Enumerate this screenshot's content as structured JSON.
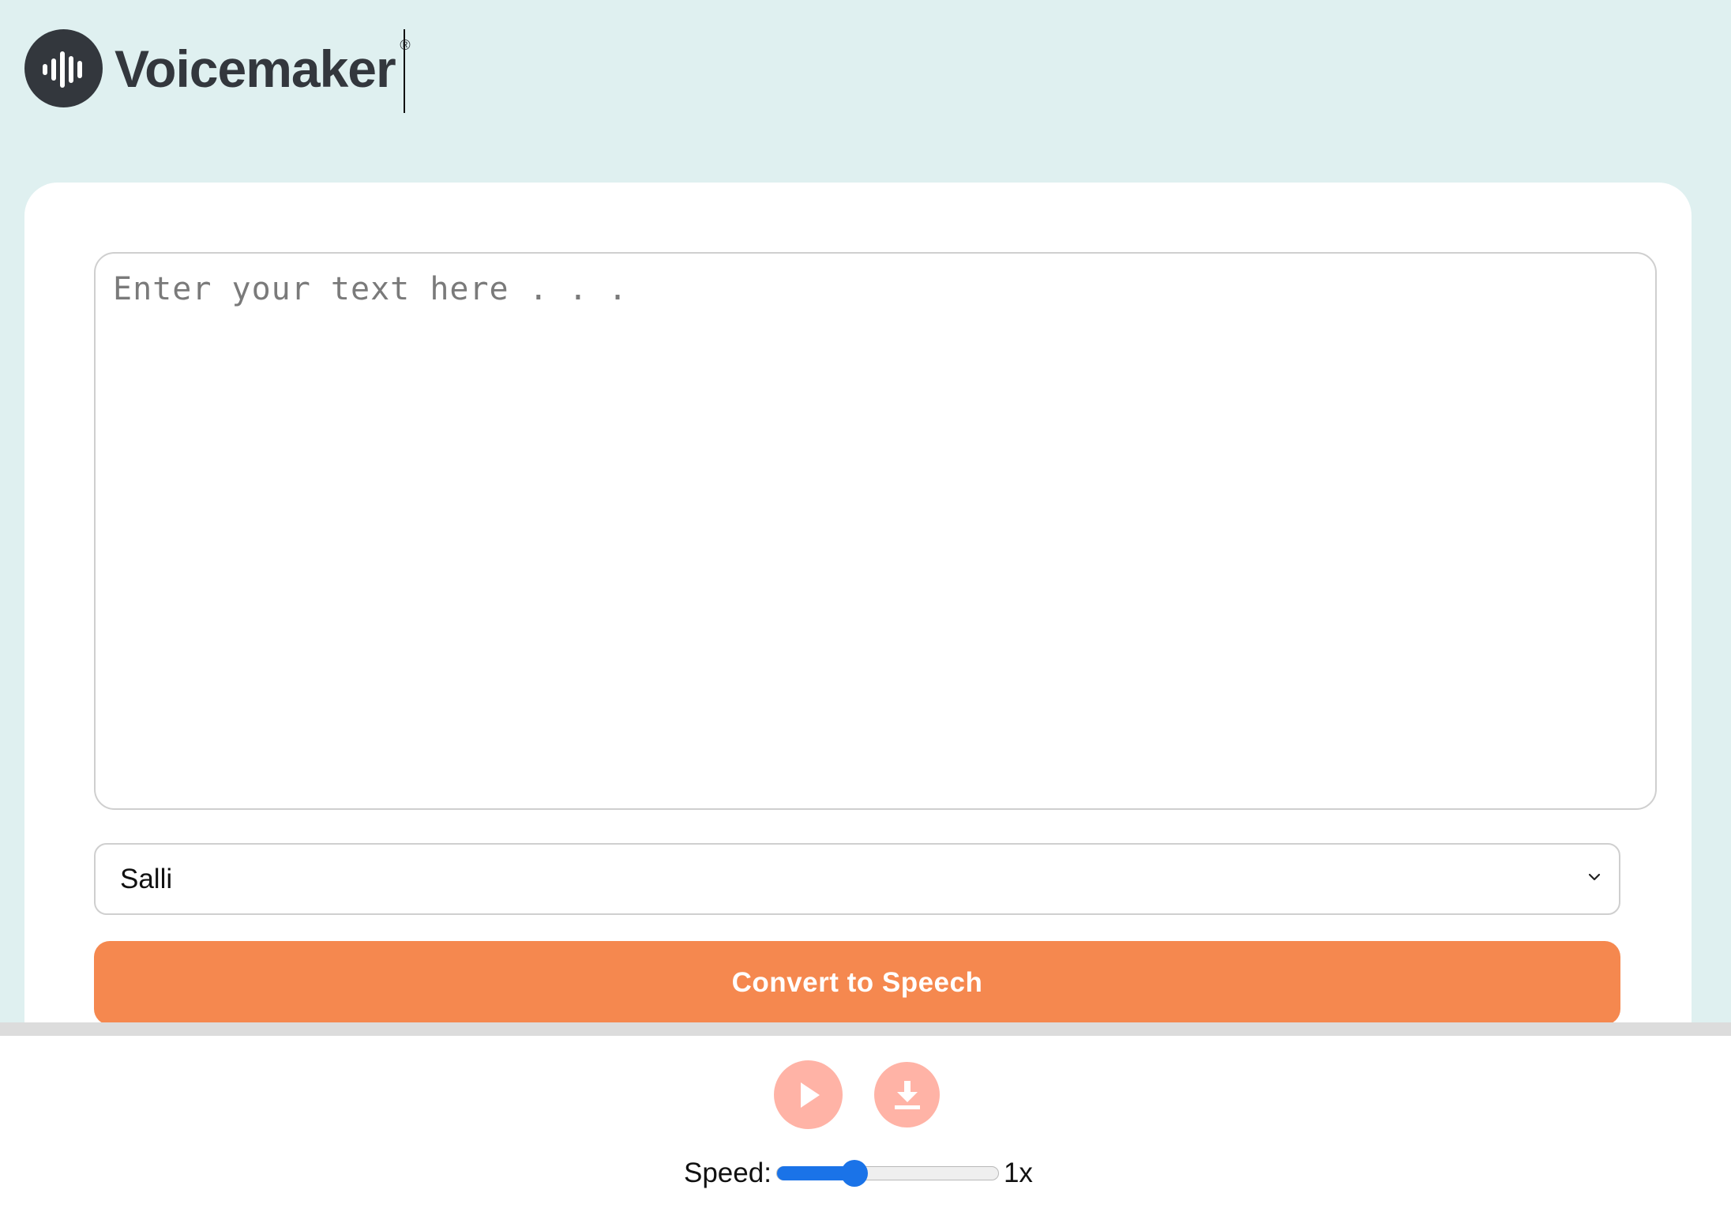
{
  "header": {
    "logo_text": "Voicemaker",
    "registered_mark": "®",
    "logo_icon": "soundwave-icon"
  },
  "editor": {
    "placeholder": "Enter your text here . . .",
    "value": ""
  },
  "voice_select": {
    "selected": "Salli",
    "icon": "chevron-down-icon"
  },
  "convert_button": {
    "label": "Convert to Speech"
  },
  "player": {
    "play_icon": "play-icon",
    "download_icon": "download-icon",
    "speed_label": "Speed:",
    "speed_value_text": "1x",
    "speed_fraction": 0.35
  },
  "colors": {
    "page_background": "#dff0f0",
    "brand_dark": "#33373d",
    "accent_orange": "#f5884f",
    "player_button": "#ffb3a6",
    "slider_blue": "#1a73e8"
  }
}
